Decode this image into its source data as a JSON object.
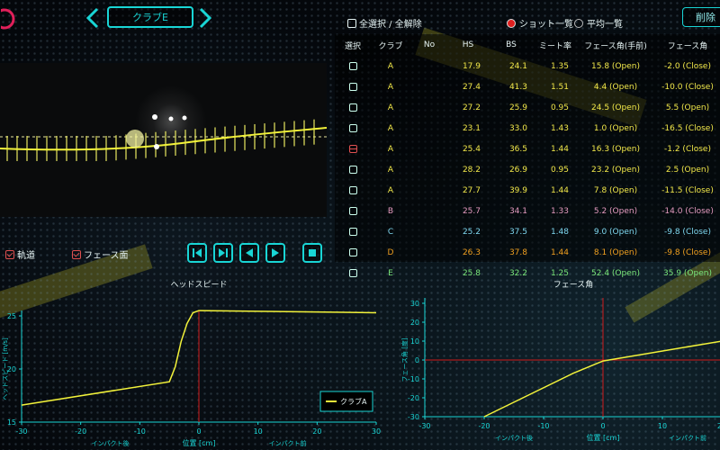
{
  "header": {
    "club_label": "クラブE",
    "select_all_label": "全選択 / 全解除",
    "shot_list_label": "ショット一覧",
    "average_list_label": "平均一覧",
    "delete_label": "削除"
  },
  "table": {
    "columns": [
      "選択",
      "クラブ",
      "No",
      "HS",
      "BS",
      "ミート率",
      "フェース角(手前)",
      "フェース角"
    ],
    "rows": [
      {
        "club": "A",
        "hs": "17.9",
        "bs": "24.1",
        "meet": "1.35",
        "face_front": "15.8 (Open)",
        "face": "-2.0 (Close)",
        "color": "#f2e84a",
        "marked": false
      },
      {
        "club": "A",
        "hs": "27.4",
        "bs": "41.3",
        "meet": "1.51",
        "face_front": "4.4 (Open)",
        "face": "-10.0 (Close)",
        "color": "#f2e84a",
        "marked": false
      },
      {
        "club": "A",
        "hs": "27.2",
        "bs": "25.9",
        "meet": "0.95",
        "face_front": "24.5 (Open)",
        "face": "5.5 (Open)",
        "color": "#f2e84a",
        "marked": false
      },
      {
        "club": "A",
        "hs": "23.1",
        "bs": "33.0",
        "meet": "1.43",
        "face_front": "1.0 (Open)",
        "face": "-16.5 (Close)",
        "color": "#f2e84a",
        "marked": false
      },
      {
        "club": "A",
        "hs": "25.4",
        "bs": "36.5",
        "meet": "1.44",
        "face_front": "16.3 (Open)",
        "face": "-1.2 (Close)",
        "color": "#f2e84a",
        "marked": true
      },
      {
        "club": "A",
        "hs": "28.2",
        "bs": "26.9",
        "meet": "0.95",
        "face_front": "23.2 (Open)",
        "face": "2.5 (Open)",
        "color": "#f2e84a",
        "marked": false
      },
      {
        "club": "A",
        "hs": "27.7",
        "bs": "39.9",
        "meet": "1.44",
        "face_front": "7.8 (Open)",
        "face": "-11.5 (Close)",
        "color": "#f2e84a",
        "marked": false
      },
      {
        "club": "B",
        "hs": "25.7",
        "bs": "34.1",
        "meet": "1.33",
        "face_front": "5.2 (Open)",
        "face": "-14.0 (Close)",
        "color": "#e59bc0",
        "marked": false
      },
      {
        "club": "C",
        "hs": "25.2",
        "bs": "37.5",
        "meet": "1.48",
        "face_front": "9.0 (Open)",
        "face": "-9.8 (Close)",
        "color": "#7fd8f0",
        "marked": false
      },
      {
        "club": "D",
        "hs": "26.3",
        "bs": "37.8",
        "meet": "1.44",
        "face_front": "8.1 (Open)",
        "face": "-9.8 (Close)",
        "color": "#f0a020",
        "marked": false
      },
      {
        "club": "E",
        "hs": "25.8",
        "bs": "32.2",
        "meet": "1.25",
        "face_front": "52.4 (Open)",
        "face": "35.9 (Open)",
        "color": "#7be87b",
        "marked": false
      }
    ]
  },
  "toggles": {
    "trajectory_label": "軌道",
    "face_plane_label": "フェース面"
  },
  "colors": {
    "accent": "#19d5d5",
    "curve": "#f2f23a",
    "impact_line": "#d01a1a"
  },
  "chart_data": [
    {
      "type": "line",
      "title": "ヘッドスピード",
      "xlabel": "位置 [cm]",
      "ylabel": "ヘッドスピード [m/s]",
      "x_note_left": "インパクト後",
      "x_note_right": "インパクト前",
      "xlim": [
        -30,
        30
      ],
      "ylim": [
        15,
        25
      ],
      "xticks": [
        -30,
        -20,
        -10,
        0,
        10,
        20,
        30
      ],
      "yticks": [
        15,
        20,
        25
      ],
      "legend": "クラブA",
      "series": [
        {
          "name": "クラブA",
          "x": [
            -30,
            -5,
            -4,
            -3,
            -2,
            -1,
            0,
            30
          ],
          "y": [
            16.6,
            18.8,
            20.2,
            22.6,
            24.3,
            25.3,
            25.5,
            25.3
          ]
        }
      ]
    },
    {
      "type": "line",
      "title": "フェース角",
      "xlabel": "位置 [cm]",
      "ylabel": "フェース角 [度]",
      "x_note_left": "インパクト後",
      "x_note_right": "インパクト前",
      "xlim": [
        -30,
        20
      ],
      "ylim": [
        -30,
        30
      ],
      "xticks": [
        -30,
        -20,
        -10,
        0,
        10,
        20
      ],
      "yticks": [
        -30,
        -20,
        -10,
        0,
        10,
        20,
        30
      ],
      "series": [
        {
          "name": "",
          "x": [
            -20,
            -5,
            0,
            20
          ],
          "y": [
            -30,
            -7,
            -0.5,
            10
          ]
        }
      ]
    }
  ]
}
